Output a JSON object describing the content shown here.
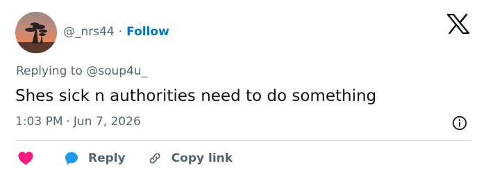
{
  "author": {
    "handle": "@_nrs44",
    "separator": "·",
    "follow_label": "Follow",
    "avatar_icon": "sunset-tree-avatar"
  },
  "header": {
    "logo_icon": "x-logo-icon"
  },
  "reply_context": {
    "prefix": "Replying to ",
    "mention": "@soup4u_"
  },
  "tweet": {
    "text": "Shes sick n authorities need to do something"
  },
  "meta": {
    "time": "1:03 PM",
    "separator": "·",
    "date": "Jun 7, 2026",
    "info_icon": "info-icon"
  },
  "actions": {
    "like_icon": "heart-icon",
    "reply_icon": "chat-bubble-icon",
    "reply_label": "Reply",
    "copy_icon": "link-icon",
    "copy_label": "Copy link"
  },
  "colors": {
    "follow": "#0073cc",
    "muted_text": "#536471",
    "primary_text": "#0f1419",
    "like": "#f91880",
    "reply": "#1d9bf0",
    "divider": "#cfd9de"
  }
}
